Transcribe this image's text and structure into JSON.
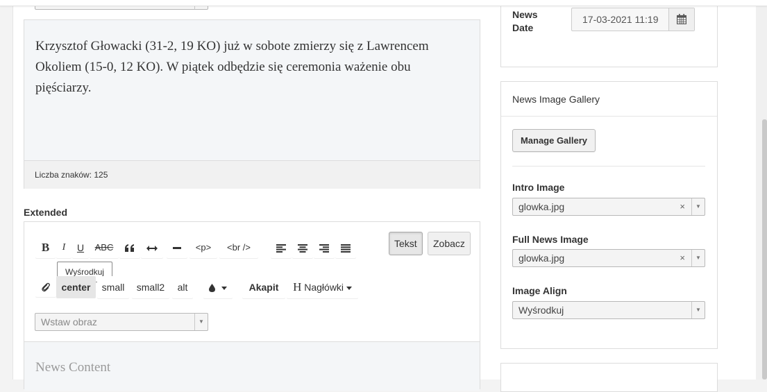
{
  "intro_editor": {
    "text": "Krzysztof Głowacki (31-2, 19 KO) już w sobote zmierzy się z Lawrencem Okoliem (15-0, 12 KO). W piątek odbędzie się ceremonia ważenie obu pięściarzy.",
    "char_count": "Liczba znaków: 125"
  },
  "extended": {
    "label": "Extended",
    "toolbar": {
      "bold": "B",
      "italic": "I",
      "underline": "U",
      "strike": "ABC",
      "p": "<p>",
      "br": "<br />",
      "tab_text": "Tekst",
      "tab_view": "Zobacz",
      "tooltip": "Wyśrodkuj",
      "center": "center",
      "small": "small",
      "small2": "small2",
      "alt": "alt",
      "akapit": "Akapit",
      "headings_h": "H",
      "headings": "Nagłówki"
    },
    "insert_image_placeholder": "Wstaw obraz",
    "content_placeholder": "News Content"
  },
  "sidebar": {
    "date_label": "News Date",
    "date_value": "17-03-2021 11:19",
    "gallery_title": "News Image Gallery",
    "manage_gallery": "Manage Gallery",
    "intro_image_label": "Intro Image",
    "intro_image_value": "glowka.jpg",
    "full_image_label": "Full News Image",
    "full_image_value": "glowka.jpg",
    "image_align_label": "Image Align",
    "image_align_value": "Wyśrodkuj",
    "clear_symbol": "×"
  }
}
